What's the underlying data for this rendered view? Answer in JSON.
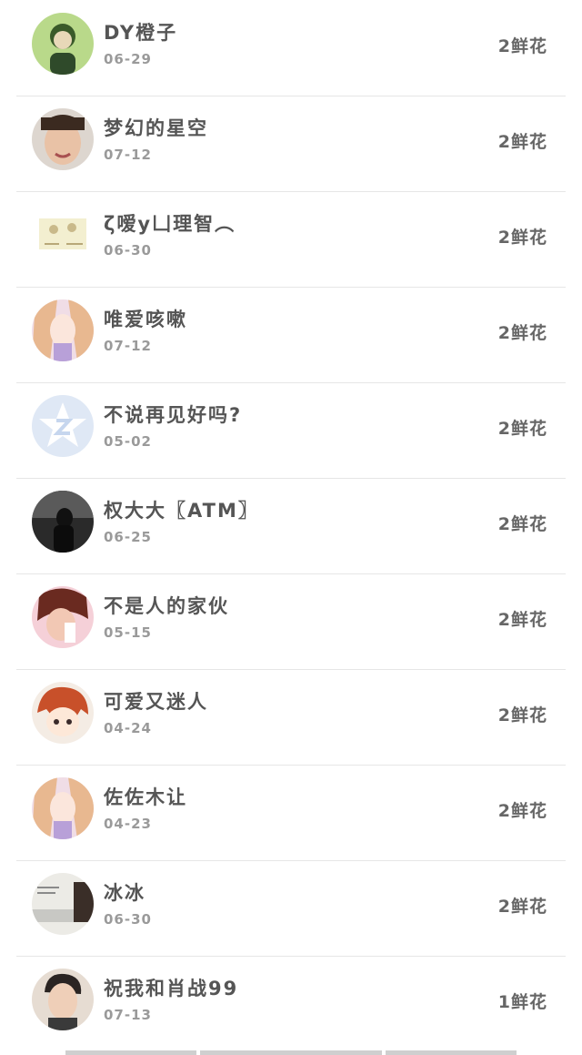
{
  "flower_list": {
    "items": [
      {
        "name": "DY橙子",
        "date": "06-29",
        "flowers": "2鲜花",
        "avatar": "boy-cartoon"
      },
      {
        "name": "梦幻的星空",
        "date": "07-12",
        "flowers": "2鲜花",
        "avatar": "boy-photo"
      },
      {
        "name": "ζ嗳y凵理智︵",
        "date": "06-30",
        "flowers": "2鲜花",
        "avatar": "sketch"
      },
      {
        "name": "唯爱咳嗽",
        "date": "07-12",
        "flowers": "2鲜花",
        "avatar": "anime-girl"
      },
      {
        "name": "不说再见好吗?",
        "date": "05-02",
        "flowers": "2鲜花",
        "avatar": "qzone-default"
      },
      {
        "name": "权大大〖ATM〗",
        "date": "06-25",
        "flowers": "2鲜花",
        "avatar": "dark-figure"
      },
      {
        "name": "不是人的家伙",
        "date": "05-15",
        "flowers": "2鲜花",
        "avatar": "girl-photo"
      },
      {
        "name": "可爱又迷人",
        "date": "04-24",
        "flowers": "2鲜花",
        "avatar": "anime-redhair"
      },
      {
        "name": "佐佐木让",
        "date": "04-23",
        "flowers": "2鲜花",
        "avatar": "anime-girl"
      },
      {
        "name": "冰冰",
        "date": "06-30",
        "flowers": "2鲜花",
        "avatar": "landscape"
      },
      {
        "name": "祝我和肖战99",
        "date": "07-13",
        "flowers": "1鲜花",
        "avatar": "man-portrait"
      }
    ]
  },
  "colors": {
    "name": "#555555",
    "date": "#9a9a9a",
    "flowers": "#666666",
    "divider": "#e6e6e6"
  }
}
